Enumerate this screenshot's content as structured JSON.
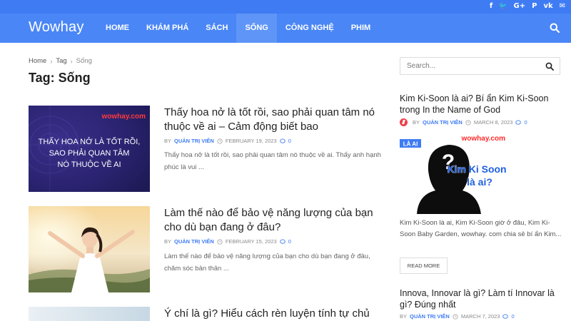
{
  "site": {
    "logo": "Wowhay"
  },
  "social": [
    "f",
    "🐦",
    "G+",
    "P",
    "vk",
    "✉"
  ],
  "nav": {
    "items": [
      {
        "label": "HOME"
      },
      {
        "label": "KHÁM PHÁ"
      },
      {
        "label": "SÁCH"
      },
      {
        "label": "SỐNG"
      },
      {
        "label": "CÔNG NGHỆ"
      },
      {
        "label": "PHIM"
      }
    ],
    "active": "SỐNG"
  },
  "breadcrumb": {
    "home": "Home",
    "tag": "Tag",
    "current": "Sống",
    "sep": "›"
  },
  "page": {
    "title": "Tag: Sống"
  },
  "posts": [
    {
      "title": "Thấy hoa nở là tốt rồi, sao phải quan tâm nó thuộc về ai – Cảm động biết bao",
      "by": "BY",
      "author": "QUẢN TRỊ VIÊN",
      "date": "FEBRUARY 19, 2023",
      "comments": "0",
      "excerpt": "Thấy hoa nở là tốt rồi, sao phải quan tâm nó thuộc về ai. Thấy anh hạnh phúc là vui ...",
      "thumb_brand": "wowhay.com",
      "thumb_text": [
        "THẤY HOA NỞ LÀ TỐT RỒI,",
        "SAO PHẢI QUAN TÂM",
        "NÓ THUỘC VỀ AI"
      ]
    },
    {
      "title": "Làm thế nào để bảo vệ năng lượng của bạn cho dù bạn đang ở đâu?",
      "by": "BY",
      "author": "QUẢN TRỊ VIÊN",
      "date": "FEBRUARY 15, 2023",
      "comments": "0",
      "excerpt": "Làm thế nào để bảo vệ năng lượng của bạn cho dù bạn đang ở đâu, chăm sóc bản thân ..."
    },
    {
      "title": "Ý chí là gì? Hiểu cách rèn luyện tính tự chủ"
    }
  ],
  "search": {
    "placeholder": "Search..."
  },
  "sidebar": {
    "featured": {
      "title": "Kim Ki-Soon là ai? Bí ẩn Kim Ki-Soon trong In the Name of God",
      "by": "BY",
      "author": "QUẢN TRỊ VIÊN",
      "date": "MARCH 8, 2023",
      "comments": "0",
      "img_brand": "wowhay.com",
      "img_tag": "LÀ AI",
      "img_question": "?",
      "img_text": [
        "Kim Ki Soon",
        "là ai?"
      ],
      "excerpt": "Kim Ki-Soon là ai, Kim Ki-Soon giờ ở đâu, Kim Ki-Soon Baby Garden, wowhay. com chia sẻ bí ẩn Kim...",
      "read_more": "READ MORE"
    },
    "second": {
      "title": "Innova, Innovar là gì? Làm tí Innovar là gì? Đúng nhất",
      "by": "BY",
      "author": "QUẢN TRỊ VIÊN",
      "date": "MARCH 7, 2023",
      "comments": "0"
    }
  },
  "colors": {
    "brand": "#4a86f6",
    "topbar": "#3f7cf4",
    "accent": "#3f7cf4",
    "trending": "#f0404a"
  }
}
